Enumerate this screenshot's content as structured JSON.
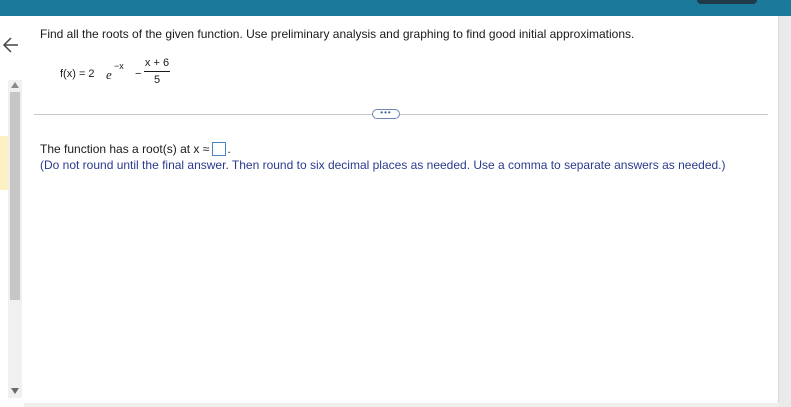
{
  "question": {
    "text": "Find all the roots of the given function. Use preliminary analysis and graphing to find good initial approximations."
  },
  "formula": {
    "lhs": "f(x) = 2",
    "base": "e",
    "exponent": "−x",
    "minus": "−",
    "numerator": "x + 6",
    "denominator": "5"
  },
  "more_button": {
    "label": "•••"
  },
  "answer": {
    "prefix": "The function has a root(s) at x ≈",
    "input_value": "",
    "suffix": "."
  },
  "instruction": {
    "text": "(Do not round until the final answer. Then round to six decimal places as needed. Use a comma to separate answers as needed.)"
  },
  "colors": {
    "top_bar": "#1b7a99",
    "instruction_text": "#2a3b8f",
    "input_border": "#4a7fc1"
  }
}
